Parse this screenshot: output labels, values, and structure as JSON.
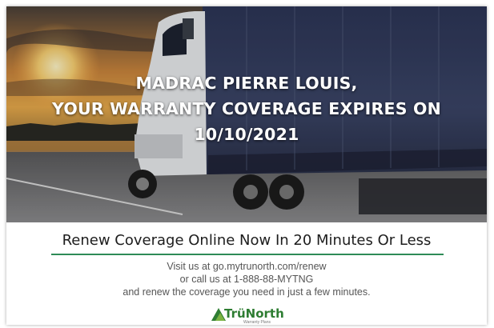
{
  "hero": {
    "line1": "MADRAC PIERRE LOUIS,",
    "line2": "YOUR WARRANTY COVERAGE EXPIRES ON",
    "line3": "10/10/2021"
  },
  "cta": {
    "headline": "Renew Coverage Online Now In 20 Minutes Or Less",
    "visit": "Visit us at go.mytrunorth.com/renew",
    "call": "or call us at 1-888-88-MYTNG",
    "renew": "and renew the coverage you need in just a few minutes."
  },
  "logo": {
    "name": "TrüNorth",
    "tagline": "Warranty Plans"
  },
  "colors": {
    "accent_green": "#2e8b57",
    "logo_green": "#2e7d32"
  }
}
